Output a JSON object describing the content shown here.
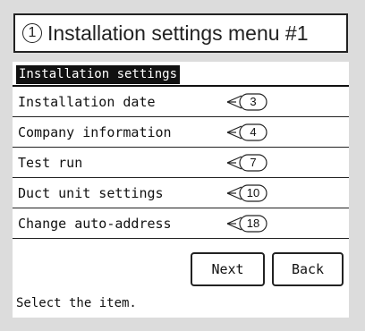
{
  "title": {
    "number": "1",
    "text": "Installation settings menu #1"
  },
  "screen": {
    "header": "Installation settings",
    "items": [
      {
        "label": "Installation date",
        "page": "3"
      },
      {
        "label": "Company information",
        "page": "4"
      },
      {
        "label": "Test run",
        "page": "7"
      },
      {
        "label": "Duct unit settings",
        "page": "10"
      },
      {
        "label": "Change auto-address",
        "page": "18"
      }
    ],
    "buttons": {
      "next": "Next",
      "back": "Back"
    },
    "status": "Select the item."
  }
}
